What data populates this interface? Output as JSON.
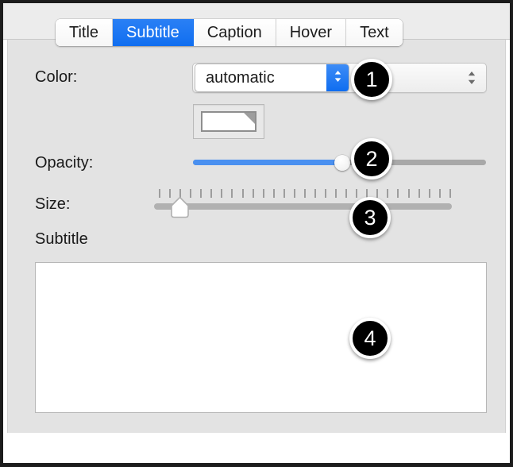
{
  "window": {
    "frame_color": "#1c1c1c",
    "pane_background": "#e3e3e3",
    "accent_blue": "#1874f0"
  },
  "tabs": [
    {
      "label": "Title",
      "selected": false
    },
    {
      "label": "Subtitle",
      "selected": true
    },
    {
      "label": "Caption",
      "selected": false
    },
    {
      "label": "Hover",
      "selected": false
    },
    {
      "label": "Text",
      "selected": false
    }
  ],
  "form": {
    "color": {
      "label": "Color:",
      "value": "automatic",
      "pulldown_icon": "chevron-up-down-icon",
      "outer_icon": "chevron-up-down-icon",
      "swatch_name": "color-swatch-white"
    },
    "opacity": {
      "label": "Opacity:",
      "fill_color": "#4a90f0",
      "track_color": "#a8a8a8",
      "value_percent": 51
    },
    "size": {
      "label": "Size:",
      "track_color": "#b1b1b1",
      "tick_count": 29,
      "value_percent": 8
    },
    "subtitle": {
      "label": "Subtitle",
      "value": "",
      "placeholder": ""
    }
  },
  "callouts": [
    {
      "number": "1"
    },
    {
      "number": "2"
    },
    {
      "number": "3"
    },
    {
      "number": "4"
    }
  ]
}
